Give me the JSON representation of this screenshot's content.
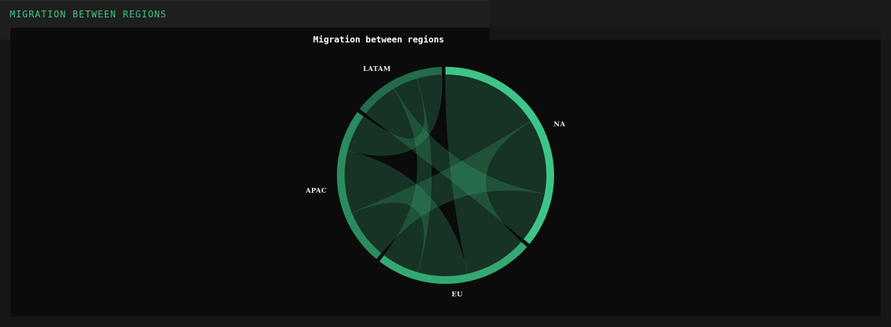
{
  "panel": {
    "title": "MIGRATION BETWEEN REGIONS"
  },
  "chart_data": {
    "type": "chord",
    "title": "Migration between regions",
    "groups": [
      "NA",
      "EU",
      "APAC",
      "LATAM"
    ],
    "colors": {
      "NA": "#3ec489",
      "EU": "#34a873",
      "APAC": "#2b8b60",
      "LATAM": "#226b4b",
      "ribbon": "#3fc486",
      "title": "#3fc486"
    },
    "matrix": [
      [
        0,
        40,
        30,
        20
      ],
      [
        25,
        0,
        20,
        15
      ],
      [
        20,
        25,
        0,
        15
      ],
      [
        15,
        10,
        10,
        0
      ]
    ]
  }
}
